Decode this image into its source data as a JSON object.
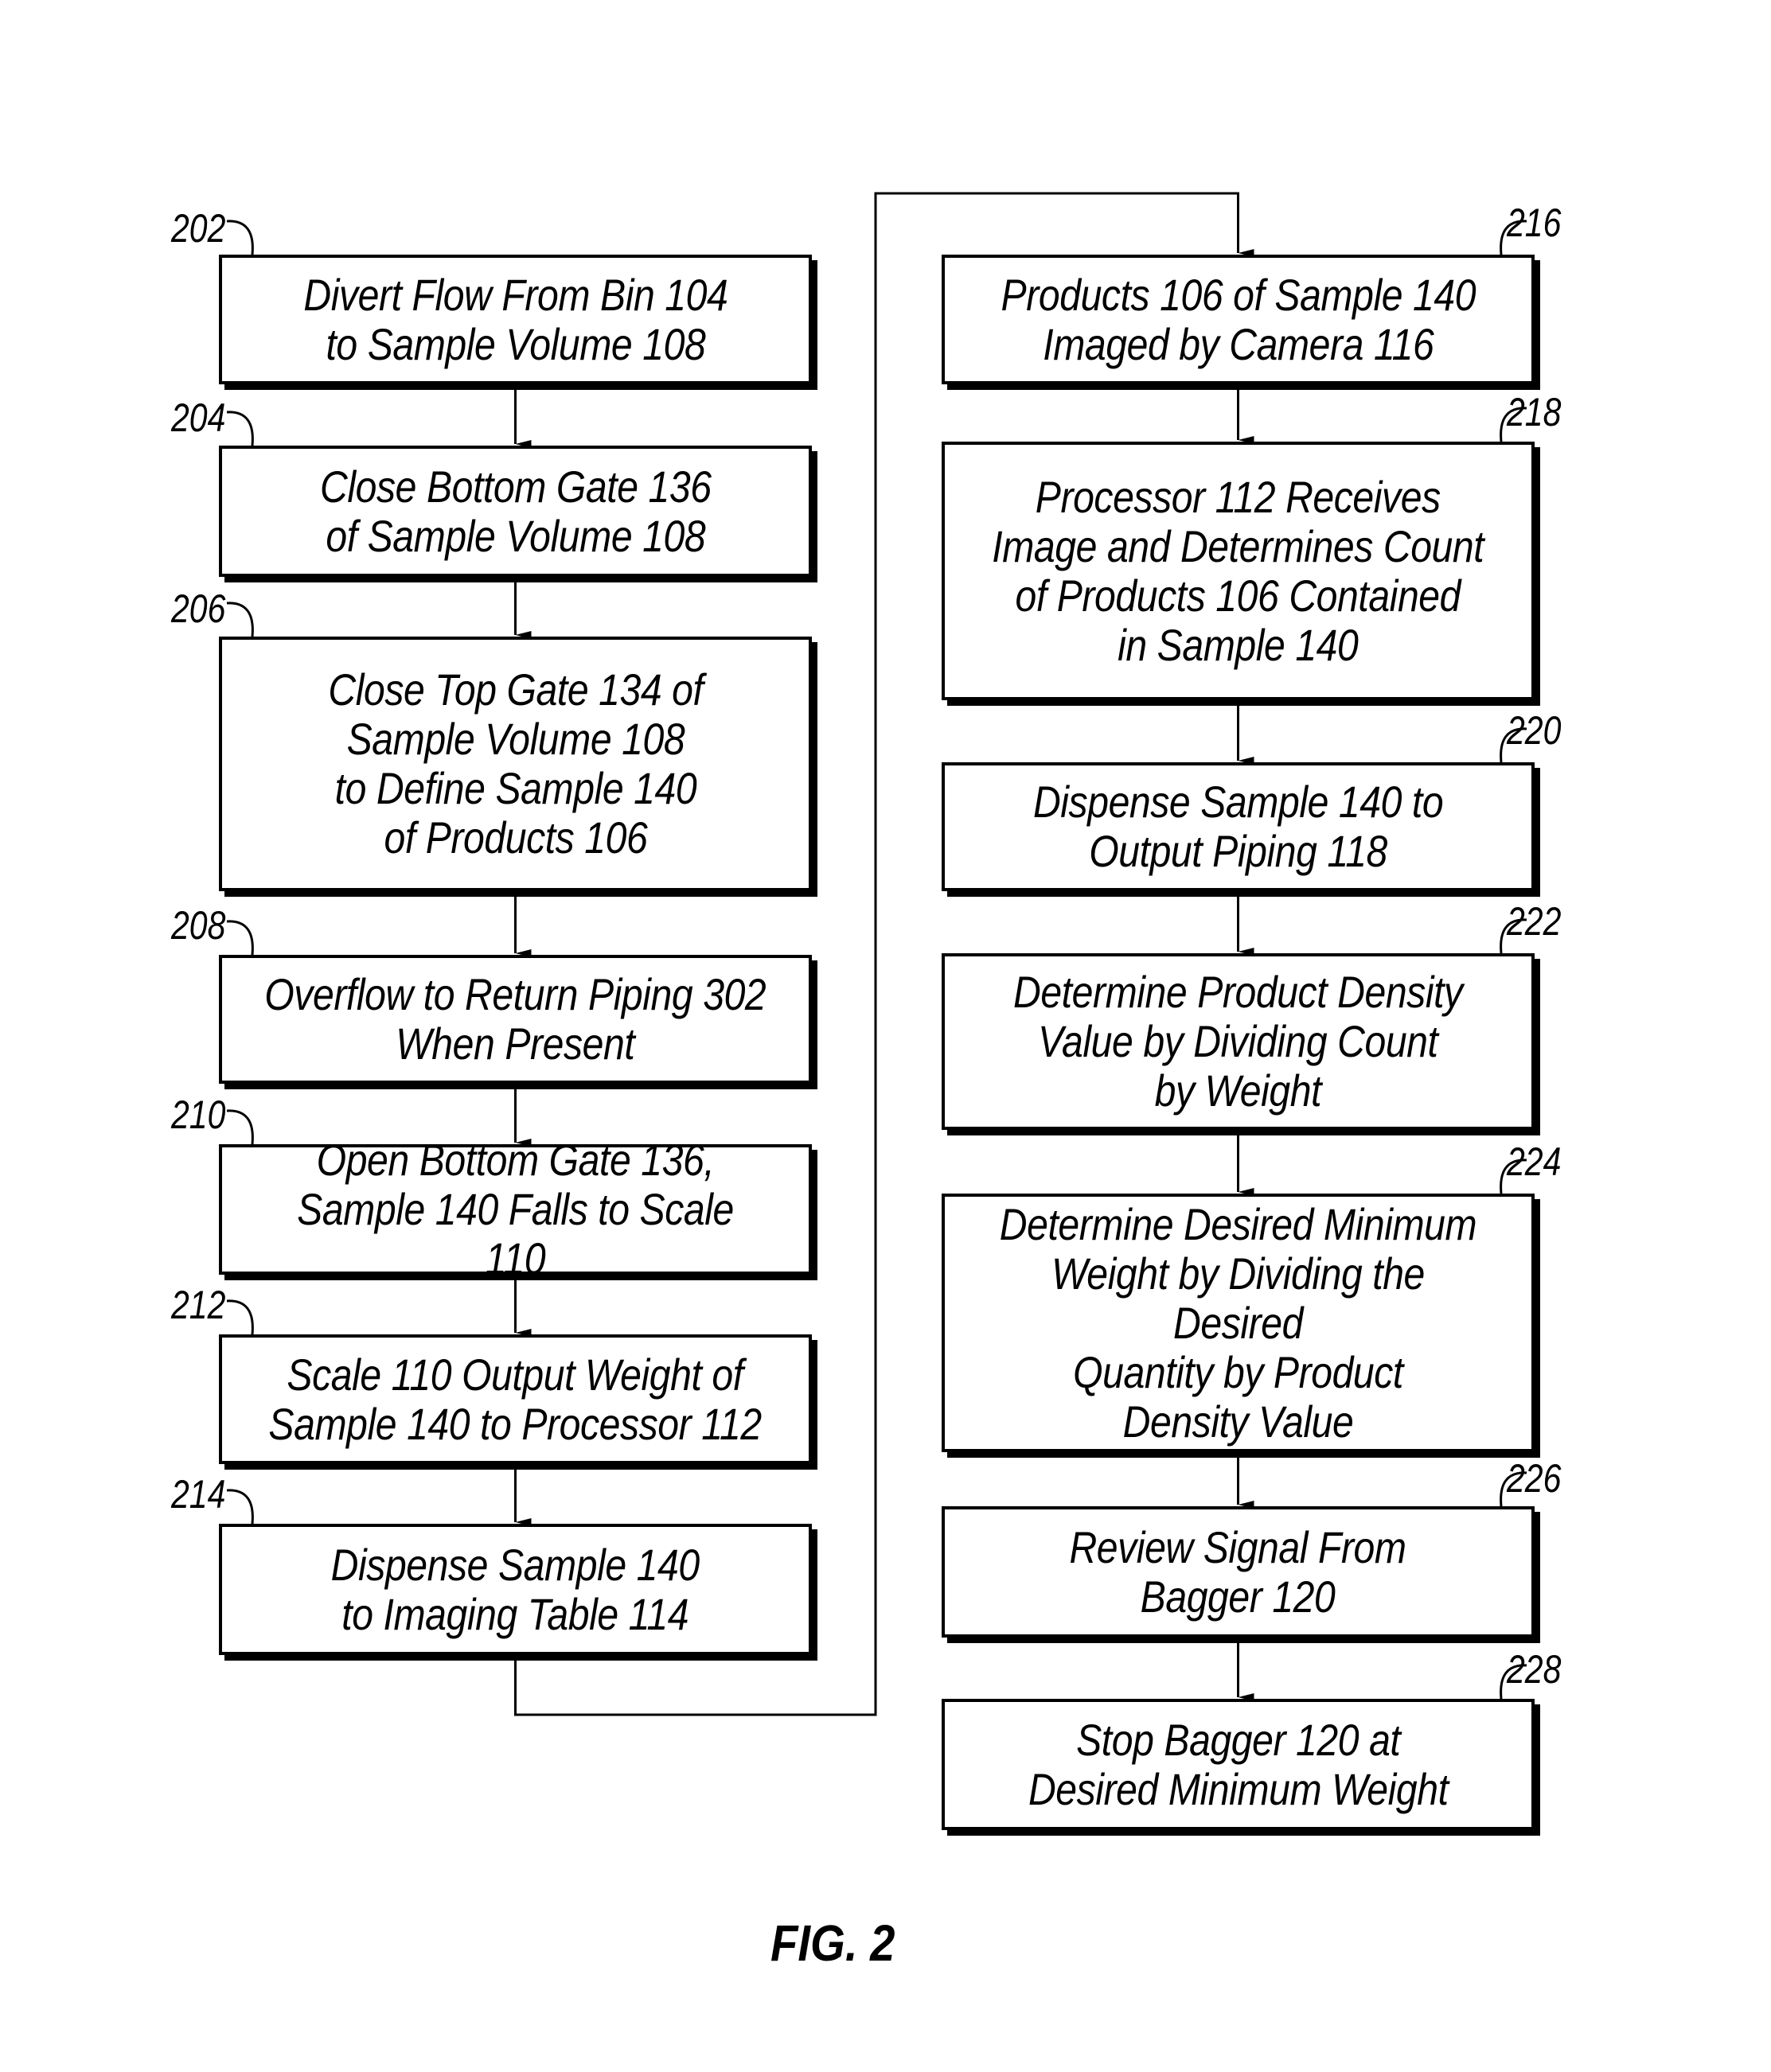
{
  "figure": {
    "caption": "FIG. 2",
    "type": "flowchart"
  },
  "left_column": {
    "steps": [
      {
        "ref": "202",
        "text": "Divert Flow From Bin 104\nto Sample Volume 108"
      },
      {
        "ref": "204",
        "text": "Close Bottom Gate 136\nof Sample Volume 108"
      },
      {
        "ref": "206",
        "text": "Close Top Gate 134 of\nSample Volume 108\nto Define Sample 140\nof Products 106"
      },
      {
        "ref": "208",
        "text": "Overflow to Return Piping 302\nWhen Present"
      },
      {
        "ref": "210",
        "text": "Open Bottom Gate 136,\nSample 140 Falls to Scale 110"
      },
      {
        "ref": "212",
        "text": "Scale 110 Output Weight of\nSample 140 to Processor 112"
      },
      {
        "ref": "214",
        "text": "Dispense Sample 140\nto Imaging Table 114"
      }
    ]
  },
  "right_column": {
    "steps": [
      {
        "ref": "216",
        "text": "Products 106 of Sample 140\nImaged by Camera 116"
      },
      {
        "ref": "218",
        "text": "Processor 112 Receives\nImage and Determines Count\nof Products 106 Contained\nin Sample 140"
      },
      {
        "ref": "220",
        "text": "Dispense Sample 140 to\nOutput Piping 118"
      },
      {
        "ref": "222",
        "text": "Determine Product Density\nValue by Dividing Count\nby Weight"
      },
      {
        "ref": "224",
        "text": "Determine Desired Minimum\nWeight by Dividing the Desired\nQuantity by Product\nDensity Value"
      },
      {
        "ref": "226",
        "text": "Review Signal From\nBagger 120"
      },
      {
        "ref": "228",
        "text": "Stop Bagger 120 at\nDesired Minimum Weight"
      }
    ]
  },
  "flow": {
    "order": [
      "202",
      "204",
      "206",
      "208",
      "210",
      "212",
      "214",
      "216",
      "218",
      "220",
      "222",
      "224",
      "226",
      "228"
    ],
    "connector_214_to_216": "loop-over"
  }
}
